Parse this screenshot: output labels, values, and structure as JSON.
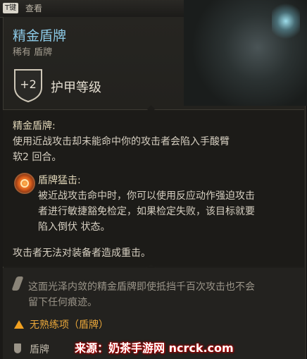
{
  "topbar": {
    "key_label": "T键",
    "inspect_label": "查看"
  },
  "item": {
    "name": "精金盾牌",
    "rarity_type": "稀有 盾牌",
    "armor_class_value": "+2",
    "armor_class_label": "护甲等级"
  },
  "passive": {
    "name": "精金盾牌:",
    "desc_line1": "使用近战攻击却未能命中你的攻击者会陷入手酸臂",
    "desc_line2": "软2 回合。"
  },
  "action": {
    "name": "盾牌猛击:",
    "desc_line1": "被近战攻击命中时，你可以使用反应动作强迫攻击",
    "desc_line2": "者进行敏捷豁免检定，如果检定失败，该目标就要",
    "desc_line3": "陷入倒伏 状态。"
  },
  "crit_immunity": "攻击者无法对装备者造成重击。",
  "flavor": {
    "line1": "这面光泽内敛的精金盾牌即使抵挡千百次攻击也不会",
    "line2": "留下任何痕迹。"
  },
  "proficiency_warning": "无熟练项（盾牌）",
  "category": "盾牌",
  "watermark": "来源：奶茶手游网 ncrck.com",
  "icons": {
    "armor_class": "shield-icon",
    "action": "shield-bash-icon",
    "flavor": "quill-icon",
    "warning": "warning-icon",
    "category": "shield-small-icon"
  },
  "colors": {
    "title": "#8cc9e6",
    "warning": "#e8a63a",
    "background": "#1a1917"
  }
}
